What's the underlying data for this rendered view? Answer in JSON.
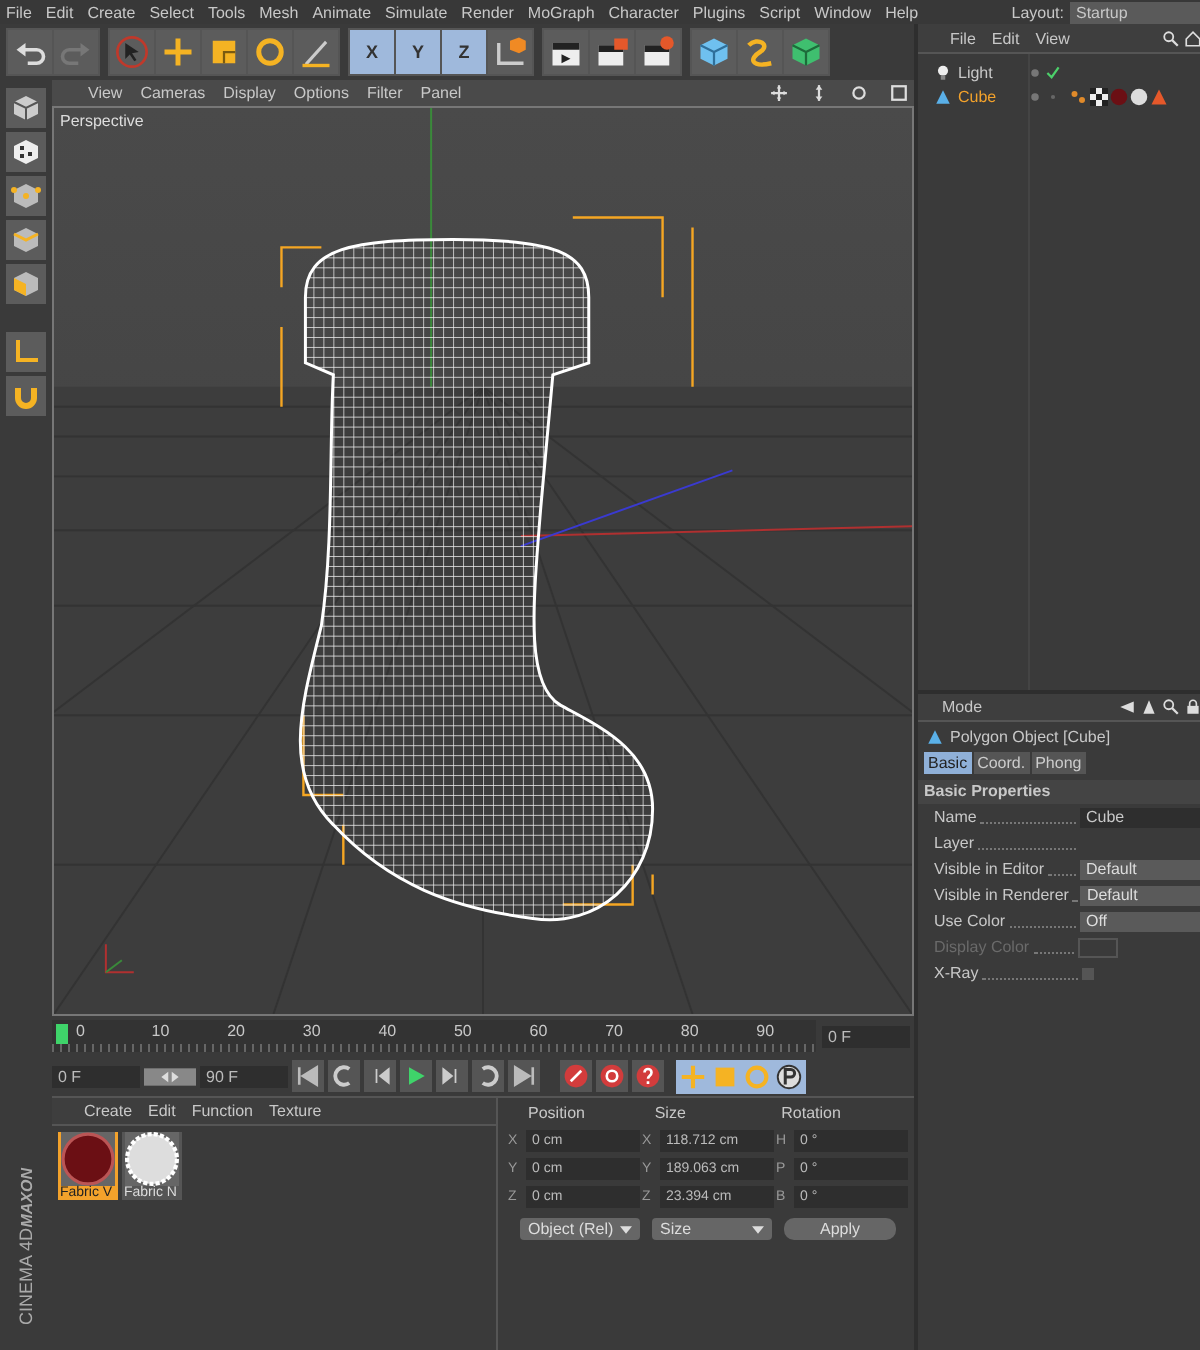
{
  "menu": [
    "File",
    "Edit",
    "Create",
    "Select",
    "Tools",
    "Mesh",
    "Animate",
    "Simulate",
    "Render",
    "MoGraph",
    "Character",
    "Plugins",
    "Script",
    "Window",
    "Help"
  ],
  "layout": {
    "label": "Layout:",
    "value": "Startup"
  },
  "axis_locks": [
    {
      "label": "X",
      "selected": true
    },
    {
      "label": "Y",
      "selected": true
    },
    {
      "label": "Z",
      "selected": true
    }
  ],
  "viewport": {
    "menu": [
      "View",
      "Cameras",
      "Display",
      "Options",
      "Filter",
      "Panel"
    ],
    "camera": "Perspective"
  },
  "timeline": {
    "ticks": [
      "0",
      "10",
      "20",
      "30",
      "40",
      "50",
      "60",
      "70",
      "80",
      "90"
    ],
    "level": 0,
    "current_frame": "0 F"
  },
  "transport": {
    "start": "0 F",
    "end": "90 F"
  },
  "materials": {
    "menu": [
      "Create",
      "Edit",
      "Function",
      "Texture"
    ],
    "items": [
      {
        "name": "Fabric V",
        "kind": "velvet",
        "selected": true
      },
      {
        "name": "Fabric N",
        "kind": "fur",
        "selected": false
      }
    ]
  },
  "coordinates": {
    "headers": [
      "Position",
      "Size",
      "Rotation"
    ],
    "rows": [
      {
        "cells": [
          {
            "axis": "X",
            "value": "0 cm"
          },
          {
            "axis": "X",
            "value": "118.712 cm"
          },
          {
            "axis": "H",
            "value": "0 °"
          }
        ]
      },
      {
        "cells": [
          {
            "axis": "Y",
            "value": "0 cm"
          },
          {
            "axis": "Y",
            "value": "189.063 cm"
          },
          {
            "axis": "P",
            "value": "0 °"
          }
        ]
      },
      {
        "cells": [
          {
            "axis": "Z",
            "value": "0 cm"
          },
          {
            "axis": "Z",
            "value": "23.394 cm"
          },
          {
            "axis": "B",
            "value": "0 °"
          }
        ]
      }
    ],
    "modes": [
      "Object (Rel)",
      "Size"
    ],
    "apply": "Apply"
  },
  "brand": {
    "maker": "MAXON",
    "product": "CINEMA 4D"
  },
  "object_manager": {
    "menu": [
      "File",
      "Edit",
      "View"
    ],
    "objects": [
      {
        "name": "Light",
        "kind": "light",
        "selected": false,
        "checked": true
      },
      {
        "name": "Cube",
        "kind": "polygon",
        "selected": true,
        "checked": false
      }
    ]
  },
  "attributes": {
    "menu": [
      "Mode"
    ],
    "title": "Polygon Object [Cube]",
    "tabs": [
      {
        "label": "Basic",
        "selected": true
      },
      {
        "label": "Coord.",
        "selected": false
      },
      {
        "label": "Phong",
        "selected": false
      }
    ],
    "section": "Basic Properties",
    "fields": [
      {
        "label": "Name",
        "kind": "text",
        "value": "Cube",
        "disabled": false
      },
      {
        "label": "Layer",
        "kind": "text",
        "disabled": false
      },
      {
        "label": "Visible in Editor",
        "kind": "dropdown",
        "value": "Default",
        "disabled": false
      },
      {
        "label": "Visible in Renderer",
        "kind": "dropdown",
        "value": "Default",
        "disabled": false
      },
      {
        "label": "Use Color",
        "kind": "dropdown",
        "value": "Off",
        "disabled": false
      },
      {
        "label": "Display Color",
        "kind": "color",
        "disabled": true
      },
      {
        "label": "X-Ray",
        "kind": "checkbox",
        "checked": false,
        "disabled": false
      }
    ]
  }
}
